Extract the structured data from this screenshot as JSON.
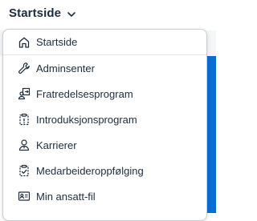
{
  "header": {
    "title": "Startside",
    "dropdown_icon": "chevron-down-icon"
  },
  "menu": {
    "items": [
      {
        "label": "Startside",
        "icon": "home-icon"
      },
      {
        "label": "Adminsenter",
        "icon": "wrench-icon"
      },
      {
        "label": "Fratredelsesprogram",
        "icon": "person-exit-icon"
      },
      {
        "label": "Introduksjonsprogram",
        "icon": "clipboard-icon"
      },
      {
        "label": "Karrierer",
        "icon": "person-icon"
      },
      {
        "label": "Medarbeideroppfølging",
        "icon": "clipboard-check-icon"
      },
      {
        "label": "Min ansatt-fil",
        "icon": "id-card-icon"
      }
    ]
  },
  "colors": {
    "text": "#1d2d3e",
    "accent": "#0a6ed1",
    "border": "#c9cdd1"
  }
}
